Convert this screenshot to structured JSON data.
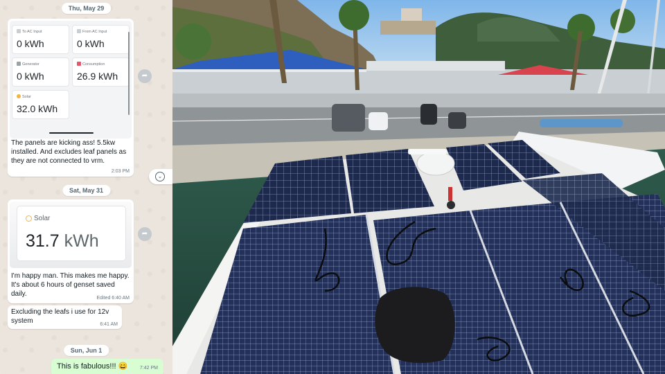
{
  "chat": {
    "date_1": "Thu, May 29",
    "tiles": [
      {
        "label": "To AC Input",
        "value": "0 kWh"
      },
      {
        "label": "From AC Input",
        "value": "0 kWh"
      },
      {
        "label": "Generator",
        "value": "0 kWh"
      },
      {
        "label": "Consumption",
        "value": "26.9 kWh"
      },
      {
        "label": "Solar",
        "value": "32.0 kWh"
      }
    ],
    "msg_1_text": "The panels are kicking ass! 5.5kw installed. And excludes leaf panels as they are not connected to vrm.",
    "msg_1_time": "2:03 PM",
    "date_2": "Sat, May 31",
    "solar_card": {
      "label": "Solar",
      "value": "31.7",
      "unit": "kWh"
    },
    "msg_2_text": "I'm happy man. This makes me happy. It's about 6 hours of genset saved daily.",
    "msg_2_time": "Edited 6:40 AM",
    "msg_3_text": "Excluding the leafs i use for 12v system",
    "msg_3_time": "6:41 AM",
    "date_3": "Sun, Jun 1",
    "msg_4_text": "This is fabulous!!! 😄",
    "msg_4_time": "7:42 PM",
    "colors": {
      "chat_bg": "#ece5dd",
      "outgoing_bubble": "#d9fdd3",
      "consumption_icon": "#e8556b",
      "solar_icon": "#f3b53f"
    }
  },
  "photo": {
    "description_icons": [
      "satellite-dome",
      "solar-panels"
    ]
  }
}
